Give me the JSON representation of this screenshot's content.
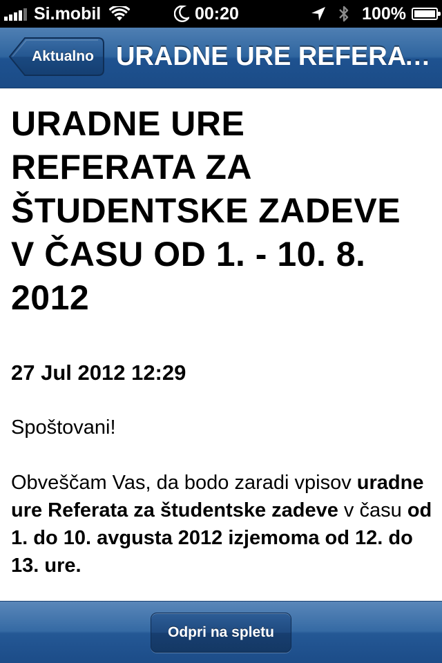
{
  "status_bar": {
    "carrier": "Si.mobil",
    "time": "00:20",
    "battery_percent": "100%",
    "battery_level": 1.0,
    "signal_bars_filled": 4,
    "signal_bars_total": 5,
    "icons": [
      "signal-icon",
      "wifi-icon",
      "moon-icon",
      "location-arrow-icon",
      "bluetooth-icon",
      "battery-icon"
    ]
  },
  "nav": {
    "back_label": "Aktualno",
    "title": "URADNE URE REFERATA ZA ŠTUDENTSKE ZADEVE V ČASU OD 1. - 10. 8. 2012"
  },
  "article": {
    "headline": "URADNE URE REFERATA ZA ŠTUDENTSKE ZADEVE V ČASU OD 1. - 10. 8. 2012",
    "date": "27 Jul 2012 12:29",
    "greeting": "Spoštovani!",
    "body_segments": [
      {
        "text": "Obveščam Vas, da bodo zaradi vpisov ",
        "bold": false
      },
      {
        "text": "uradne ure Referata za študentske zadeve",
        "bold": true
      },
      {
        "text": " v času ",
        "bold": false
      },
      {
        "text": "od 1. do 10. avgusta 2012 izjemoma od 12. do 13. ure.",
        "bold": true
      }
    ]
  },
  "toolbar": {
    "open_web_label": "Odpri na spletu"
  },
  "colors": {
    "status_bar_bg": "#000000",
    "nav_bar_blue": "#2f659f",
    "toolbar_blue": "#356aa4",
    "text": "#000000",
    "background": "#ffffff"
  }
}
